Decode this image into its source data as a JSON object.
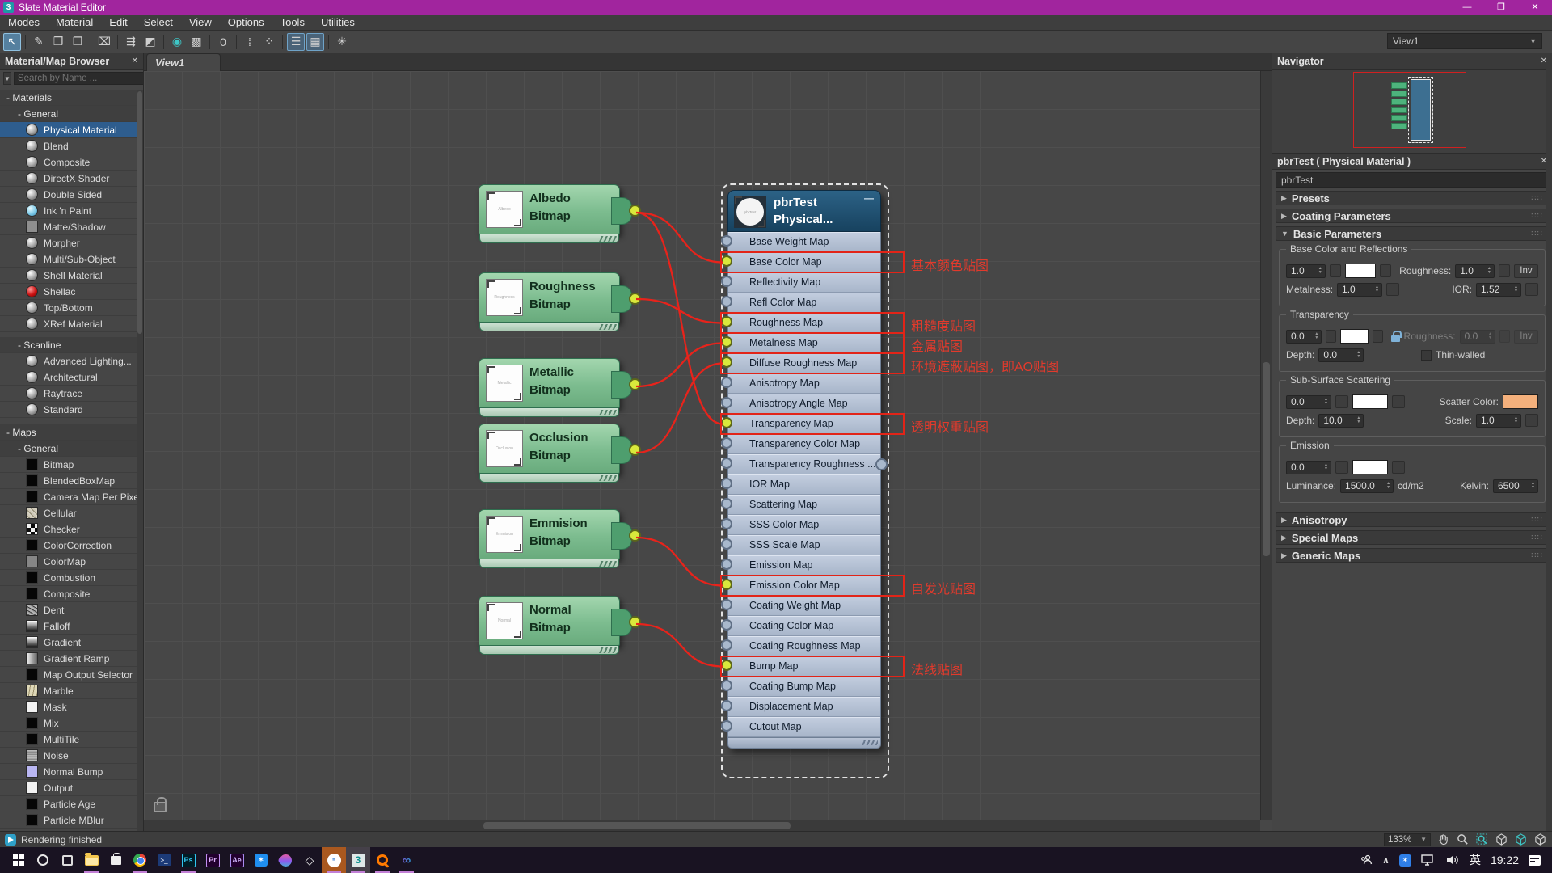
{
  "window": {
    "app_badge": "3",
    "title": "Slate Material Editor"
  },
  "menus": [
    "Modes",
    "Material",
    "Edit",
    "Select",
    "View",
    "Options",
    "Tools",
    "Utilities"
  ],
  "toolbar": {
    "view_selector": "View1",
    "icons": [
      {
        "name": "select-tool-icon",
        "glyph": "↖",
        "state": "active"
      },
      {
        "name": "pick-material-from-object-icon",
        "glyph": "✎",
        "sep_before": true
      },
      {
        "name": "put-material-to-scene-icon",
        "glyph": "❒"
      },
      {
        "name": "assign-material-to-selection-icon",
        "glyph": "❐"
      },
      {
        "name": "delete-selected-icon",
        "glyph": "⌧",
        "sep_before": true
      },
      {
        "name": "move-children-icon",
        "glyph": "⇶",
        "sep_before": true
      },
      {
        "name": "hide-unused-nodeslots-icon",
        "glyph": "◩"
      },
      {
        "name": "show-shaded-material-icon",
        "glyph": "◉",
        "tint": "teal",
        "sep_before": true
      },
      {
        "name": "show-background-icon",
        "glyph": "▩"
      },
      {
        "name": "show-standard-maps-icon",
        "glyph": "0",
        "sep_before": true
      },
      {
        "name": "incoming-connections-icon",
        "glyph": "⁞",
        "sep_before": true
      },
      {
        "name": "node-alignment-icon",
        "glyph": "⁘"
      },
      {
        "name": "material-map-browser-toggle-icon",
        "glyph": "☰",
        "state": "toggled",
        "sep_before": true
      },
      {
        "name": "parameter-editor-toggle-icon",
        "glyph": "▦",
        "state": "toggled"
      },
      {
        "name": "select-by-material-icon",
        "glyph": "✳",
        "sep_before": true
      }
    ]
  },
  "browser": {
    "title": "Material/Map Browser",
    "search_placeholder": "Search by Name ...",
    "tree": [
      {
        "type": "group",
        "level": 0,
        "label": "- Materials"
      },
      {
        "type": "group",
        "level": 1,
        "label": "- General"
      },
      {
        "type": "item",
        "level": 2,
        "label": "Physical Material",
        "swatch": "sphere",
        "selected": true
      },
      {
        "type": "item",
        "level": 2,
        "label": "Blend",
        "swatch": "sphere"
      },
      {
        "type": "item",
        "level": 2,
        "label": "Composite",
        "swatch": "sphere"
      },
      {
        "type": "item",
        "level": 2,
        "label": "DirectX Shader",
        "swatch": "sphere"
      },
      {
        "type": "item",
        "level": 2,
        "label": "Double Sided",
        "swatch": "sphere"
      },
      {
        "type": "item",
        "level": 2,
        "label": "Ink 'n Paint",
        "swatch": "sphere-blue"
      },
      {
        "type": "item",
        "level": 2,
        "label": "Matte/Shadow",
        "swatch": "flat"
      },
      {
        "type": "item",
        "level": 2,
        "label": "Morpher",
        "swatch": "sphere"
      },
      {
        "type": "item",
        "level": 2,
        "label": "Multi/Sub-Object",
        "swatch": "sphere"
      },
      {
        "type": "item",
        "level": 2,
        "label": "Shell Material",
        "swatch": "sphere"
      },
      {
        "type": "item",
        "level": 2,
        "label": "Shellac",
        "swatch": "sphere-red"
      },
      {
        "type": "item",
        "level": 2,
        "label": "Top/Bottom",
        "swatch": "sphere"
      },
      {
        "type": "item",
        "level": 2,
        "label": "XRef Material",
        "swatch": "sphere"
      },
      {
        "type": "group",
        "level": 1,
        "label": "- Scanline",
        "margin_top": 6
      },
      {
        "type": "item",
        "level": 2,
        "label": "Advanced Lighting...",
        "swatch": "sphere"
      },
      {
        "type": "item",
        "level": 2,
        "label": "Architectural",
        "swatch": "sphere"
      },
      {
        "type": "item",
        "level": 2,
        "label": "Raytrace",
        "swatch": "sphere"
      },
      {
        "type": "item",
        "level": 2,
        "label": "Standard",
        "swatch": "sphere"
      },
      {
        "type": "group",
        "level": 0,
        "label": "- Maps",
        "margin_top": 8
      },
      {
        "type": "group",
        "level": 1,
        "label": "- General"
      },
      {
        "type": "item",
        "level": 2,
        "label": "Bitmap",
        "swatch": "black"
      },
      {
        "type": "item",
        "level": 2,
        "label": "BlendedBoxMap",
        "swatch": "black"
      },
      {
        "type": "item",
        "level": 2,
        "label": "Camera Map Per Pixel",
        "swatch": "black"
      },
      {
        "type": "item",
        "level": 2,
        "label": "Cellular",
        "swatch": "cellular"
      },
      {
        "type": "item",
        "level": 2,
        "label": "Checker",
        "swatch": "checker"
      },
      {
        "type": "item",
        "level": 2,
        "label": "ColorCorrection",
        "swatch": "black"
      },
      {
        "type": "item",
        "level": 2,
        "label": "ColorMap",
        "swatch": "colormap"
      },
      {
        "type": "item",
        "level": 2,
        "label": "Combustion",
        "swatch": "black"
      },
      {
        "type": "item",
        "level": 2,
        "label": "Composite",
        "swatch": "black"
      },
      {
        "type": "item",
        "level": 2,
        "label": "Dent",
        "swatch": "dent"
      },
      {
        "type": "item",
        "level": 2,
        "label": "Falloff",
        "swatch": "falloff"
      },
      {
        "type": "item",
        "level": 2,
        "label": "Gradient",
        "swatch": "falloff"
      },
      {
        "type": "item",
        "level": 2,
        "label": "Gradient Ramp",
        "swatch": "gradienth"
      },
      {
        "type": "item",
        "level": 2,
        "label": "Map Output Selector",
        "swatch": "black"
      },
      {
        "type": "item",
        "level": 2,
        "label": "Marble",
        "swatch": "marble"
      },
      {
        "type": "item",
        "level": 2,
        "label": "Mask",
        "swatch": "white"
      },
      {
        "type": "item",
        "level": 2,
        "label": "Mix",
        "swatch": "black"
      },
      {
        "type": "item",
        "level": 2,
        "label": "MultiTile",
        "swatch": "black"
      },
      {
        "type": "item",
        "level": 2,
        "label": "Noise",
        "swatch": "noise"
      },
      {
        "type": "item",
        "level": 2,
        "label": "Normal Bump",
        "swatch": "normalbump"
      },
      {
        "type": "item",
        "level": 2,
        "label": "Output",
        "swatch": "white"
      },
      {
        "type": "item",
        "level": 2,
        "label": "Particle Age",
        "swatch": "black"
      },
      {
        "type": "item",
        "level": 2,
        "label": "Particle MBlur",
        "swatch": "black"
      }
    ]
  },
  "canvas": {
    "tab": "View1",
    "zoom_level": "133%",
    "bitmap_nodes": [
      {
        "title": "Albedo",
        "subtitle": "Bitmap"
      },
      {
        "title": "Roughness",
        "subtitle": "Bitmap"
      },
      {
        "title": "Metallic",
        "subtitle": "Bitmap"
      },
      {
        "title": "Occlusion",
        "subtitle": "Bitmap"
      },
      {
        "title": "Emmision",
        "subtitle": "Bitmap"
      },
      {
        "title": "Normal",
        "subtitle": "Bitmap"
      }
    ],
    "pbr_node": {
      "title": "pbrTest",
      "subtitle": "Physical...",
      "rows": [
        {
          "label": "Base Weight Map"
        },
        {
          "label": "Base Color Map",
          "connected": true,
          "boxed": true,
          "note": "基本颜色贴图"
        },
        {
          "label": "Reflectivity Map"
        },
        {
          "label": "Refl Color Map"
        },
        {
          "label": "Roughness Map",
          "connected": true,
          "boxed": true,
          "note": "粗糙度贴图"
        },
        {
          "label": "Metalness Map",
          "connected": true,
          "boxed": true,
          "note": "金属贴图"
        },
        {
          "label": "Diffuse Roughness Map",
          "connected": true,
          "boxed": true,
          "note": "环境遮蔽贴图，即AO贴图"
        },
        {
          "label": "Anisotropy Map"
        },
        {
          "label": "Anisotropy Angle Map"
        },
        {
          "label": "Transparency Map",
          "connected": true,
          "boxed": true,
          "note": "透明权重贴图"
        },
        {
          "label": "Transparency Color Map"
        },
        {
          "label": "Transparency  Roughness ..."
        },
        {
          "label": "IOR Map"
        },
        {
          "label": "Scattering Map"
        },
        {
          "label": "SSS Color Map"
        },
        {
          "label": "SSS Scale Map"
        },
        {
          "label": "Emission Map"
        },
        {
          "label": "Emission Color Map",
          "connected": true,
          "boxed": true,
          "note": "自发光贴图"
        },
        {
          "label": "Coating Weight Map"
        },
        {
          "label": "Coating Color Map"
        },
        {
          "label": "Coating Roughness Map"
        },
        {
          "label": "Bump Map",
          "connected": true,
          "boxed": true,
          "note": "法线贴图"
        },
        {
          "label": "Coating Bump Map"
        },
        {
          "label": "Displacement Map"
        },
        {
          "label": "Cutout Map"
        }
      ]
    },
    "links": [
      {
        "from": 0,
        "to": "Base Color Map"
      },
      {
        "from": 0,
        "to": "Transparency Map"
      },
      {
        "from": 1,
        "to": "Roughness Map"
      },
      {
        "from": 2,
        "to": "Metalness Map"
      },
      {
        "from": 3,
        "to": "Diffuse Roughness Map"
      },
      {
        "from": 4,
        "to": "Emission Color Map"
      },
      {
        "from": 5,
        "to": "Bump Map"
      }
    ],
    "wire_color": "#e8231b",
    "highlight_color": "#e22418"
  },
  "navigator": {
    "title": "Navigator"
  },
  "inspector": {
    "title": "pbrTest  ( Physical Material )",
    "material_name": "pbrTest",
    "collapsed_rollouts": [
      "Presets",
      "Coating Parameters"
    ],
    "basic_label": "Basic Parameters",
    "groups": [
      {
        "label": "Base Color and Reflections",
        "rows": [
          [
            {
              "t": "spin",
              "v": "1.0",
              "n": "base-weight-spinner"
            },
            {
              "t": "map",
              "n": "base-weight-map-button"
            },
            {
              "t": "swatch",
              "c": "#ffffff",
              "n": "base-color-swatch"
            },
            {
              "t": "map",
              "n": "base-color-map-button"
            },
            {
              "t": "gap"
            },
            {
              "t": "lbl",
              "v": "Roughness:"
            },
            {
              "t": "spin",
              "v": "1.0",
              "n": "roughness-spinner"
            },
            {
              "t": "map",
              "n": "roughness-map-button"
            },
            {
              "t": "btn",
              "v": "Inv",
              "n": "roughness-invert-button"
            }
          ],
          [
            {
              "t": "lbl",
              "v": "Metalness:"
            },
            {
              "t": "spin",
              "v": "1.0",
              "n": "metalness-spinner"
            },
            {
              "t": "map",
              "n": "metalness-map-button"
            },
            {
              "t": "gap"
            },
            {
              "t": "lbl",
              "v": "IOR:"
            },
            {
              "t": "spin",
              "v": "1.52",
              "n": "ior-spinner"
            },
            {
              "t": "map",
              "n": "ior-map-button"
            }
          ]
        ]
      },
      {
        "label": "Transparency",
        "rows": [
          [
            {
              "t": "spin",
              "v": "0.0",
              "n": "transparency-spinner"
            },
            {
              "t": "map",
              "n": "transparency-map-button"
            },
            {
              "t": "swatch",
              "c": "#ffffff",
              "n": "transparency-color-swatch"
            },
            {
              "t": "map",
              "n": "transparency-color-map-button"
            },
            {
              "t": "gap"
            },
            {
              "t": "lock",
              "n": "transparency-roughness-lock-icon"
            },
            {
              "t": "lbl",
              "v": "Roughness:",
              "dim": true
            },
            {
              "t": "spin",
              "v": "0.0",
              "dim": true,
              "n": "transparency-roughness-spinner"
            },
            {
              "t": "map",
              "dim": true,
              "n": "transparency-roughness-map-button"
            },
            {
              "t": "btn",
              "v": "Inv",
              "dim": true,
              "n": "transparency-roughness-invert-button"
            }
          ],
          [
            {
              "t": "lbl",
              "v": "Depth:"
            },
            {
              "t": "spin",
              "v": "0.0",
              "n": "transparency-depth-spinner"
            },
            {
              "t": "gap"
            },
            {
              "t": "check",
              "v": "Thin-walled",
              "n": "thin-walled-checkbox"
            },
            {
              "t": "gap"
            }
          ]
        ]
      },
      {
        "label": "Sub-Surface Scattering",
        "rows": [
          [
            {
              "t": "spin",
              "v": "0.0",
              "n": "scattering-spinner"
            },
            {
              "t": "map",
              "n": "scattering-map-button"
            },
            {
              "t": "swatch",
              "c": "#ffffff",
              "n": "sss-color-swatch"
            },
            {
              "t": "map",
              "n": "sss-color-map-button"
            },
            {
              "t": "gap"
            },
            {
              "t": "lbl",
              "v": "Scatter Color:"
            },
            {
              "t": "swatch",
              "c": "#f4b07c",
              "n": "scatter-color-swatch"
            }
          ],
          [
            {
              "t": "lbl",
              "v": "Depth:"
            },
            {
              "t": "spin",
              "v": "10.0",
              "n": "sss-depth-spinner"
            },
            {
              "t": "gap"
            },
            {
              "t": "lbl",
              "v": "Scale:"
            },
            {
              "t": "spin",
              "v": "1.0",
              "n": "sss-scale-spinner"
            },
            {
              "t": "map",
              "n": "sss-scale-map-button"
            }
          ]
        ]
      },
      {
        "label": "Emission",
        "rows": [
          [
            {
              "t": "spin",
              "v": "0.0",
              "n": "emission-spinner"
            },
            {
              "t": "map",
              "n": "emission-map-button"
            },
            {
              "t": "swatch",
              "c": "#ffffff",
              "n": "emission-color-swatch"
            },
            {
              "t": "map",
              "n": "emission-color-map-button"
            },
            {
              "t": "gap"
            }
          ],
          [
            {
              "t": "lbl",
              "v": "Luminance:"
            },
            {
              "t": "spin",
              "v": "1500.0",
              "wide": true,
              "n": "luminance-spinner"
            },
            {
              "t": "txt",
              "v": "cd/m2"
            },
            {
              "t": "gap"
            },
            {
              "t": "lbl",
              "v": "Kelvin:"
            },
            {
              "t": "spin",
              "v": "6500",
              "n": "kelvin-spinner"
            }
          ]
        ]
      }
    ],
    "bottom_rollouts": [
      "Anisotropy",
      "Special Maps",
      "Generic Maps"
    ]
  },
  "statusbar": {
    "message": "Rendering finished"
  },
  "taskbar": {
    "ime": "英",
    "time": "19:22",
    "icons": [
      {
        "name": "start-button",
        "kind": "start"
      },
      {
        "name": "cortana-button",
        "kind": "circle"
      },
      {
        "name": "task-view-button",
        "kind": "taskview"
      },
      {
        "name": "file-explorer-button",
        "kind": "folder",
        "running": true
      },
      {
        "name": "microsoft-store-button",
        "kind": "store"
      },
      {
        "name": "chrome-button",
        "kind": "chrome",
        "running": true
      },
      {
        "name": "powershell-button",
        "kind": "pwsh"
      },
      {
        "name": "photoshop-button",
        "kind": "ps",
        "label": "Ps",
        "running": true
      },
      {
        "name": "premiere-button",
        "kind": "pr",
        "label": "Pr"
      },
      {
        "name": "after-effects-button",
        "kind": "ae",
        "label": "Ae"
      },
      {
        "name": "tim-button",
        "kind": "star"
      },
      {
        "name": "colorful-pin-app-button",
        "kind": "drop"
      },
      {
        "name": "3d-viewer-button",
        "kind": "cube"
      },
      {
        "name": "active-orange-app-button",
        "kind": "orangeapp",
        "active": "activeO",
        "running": true
      },
      {
        "name": "3dsmax-button",
        "kind": "max",
        "label": "3",
        "active": "activeM",
        "running": true
      },
      {
        "name": "everything-search-button",
        "kind": "esearch",
        "running": true
      },
      {
        "name": "vscode-button",
        "kind": "vs",
        "running": true
      }
    ]
  }
}
